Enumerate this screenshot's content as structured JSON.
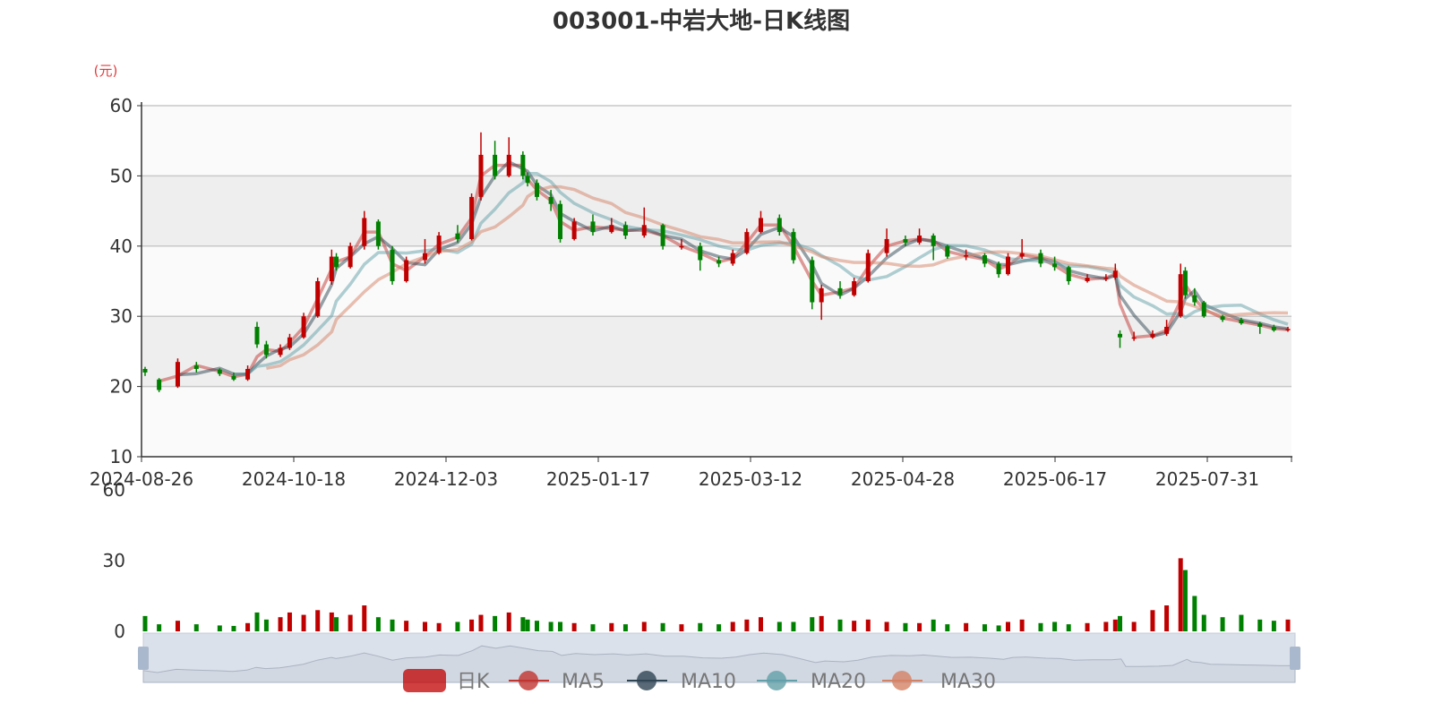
{
  "chart_data": {
    "type": "candlestick",
    "title": "003001-中岩大地-日K线图",
    "ylabel": "(元)",
    "ylim": [
      10,
      60
    ],
    "y_ticks": [
      "10",
      "20",
      "30",
      "40",
      "50",
      "60"
    ],
    "volume_ylim": [
      0,
      60
    ],
    "volume_ticks": [
      "0",
      "30",
      "60"
    ],
    "x_tick_labels": [
      "2024-08-26",
      "2024-10-18",
      "2024-12-03",
      "2025-01-17",
      "2025-03-12",
      "2025-04-28",
      "2025-06-17",
      "2025-07-31"
    ],
    "total_trading_days": 245,
    "candle_fields": [
      "day",
      "open",
      "close",
      "low",
      "high",
      "volume"
    ],
    "candles": [
      [
        0,
        22.5,
        22,
        21.5,
        22.8,
        6.5
      ],
      [
        3,
        21,
        19.5,
        19.2,
        21.2,
        3
      ],
      [
        7,
        20,
        23.5,
        19.8,
        24,
        4.5
      ],
      [
        11,
        23,
        22.5,
        22,
        23.5,
        3
      ],
      [
        16,
        22.4,
        21.8,
        21.5,
        22.6,
        2.5
      ],
      [
        19,
        21.5,
        21,
        20.8,
        22,
        2.3
      ],
      [
        22,
        21,
        22.5,
        20.8,
        23,
        3.5
      ],
      [
        24,
        28.5,
        26,
        25.5,
        29.2,
        8
      ],
      [
        26,
        26,
        24.5,
        24,
        26.5,
        5
      ],
      [
        29,
        24.5,
        25.5,
        24.2,
        26,
        6
      ],
      [
        31,
        25.5,
        27,
        25.2,
        27.5,
        8
      ],
      [
        34,
        27,
        30,
        26.8,
        30.5,
        7
      ],
      [
        37,
        30,
        35,
        29.8,
        35.5,
        9
      ],
      [
        40,
        35,
        38.5,
        34.5,
        39.5,
        8
      ],
      [
        41,
        38.5,
        37,
        36.5,
        39,
        6
      ],
      [
        44,
        37,
        40,
        36.8,
        40.5,
        7
      ],
      [
        47,
        40,
        44,
        39.5,
        45,
        11
      ],
      [
        50,
        43.5,
        40,
        39.5,
        43.8,
        6
      ],
      [
        53,
        39.5,
        35,
        34.5,
        40,
        5
      ],
      [
        56,
        35,
        38,
        34.8,
        38.5,
        4.5
      ],
      [
        60,
        38,
        39,
        37.5,
        41,
        4
      ],
      [
        63,
        39,
        41.5,
        38.8,
        42,
        3.5
      ],
      [
        67,
        41.8,
        41,
        40.5,
        43,
        4
      ],
      [
        70,
        41,
        47,
        40.8,
        47.5,
        5
      ],
      [
        72,
        47,
        53,
        46.5,
        56.2,
        7
      ],
      [
        75,
        53,
        50,
        49.5,
        55,
        6.5
      ],
      [
        78,
        50,
        53,
        49.8,
        55.5,
        8
      ],
      [
        81,
        53,
        50,
        49.5,
        53.5,
        6
      ],
      [
        82,
        50,
        49,
        48.5,
        50.5,
        5
      ],
      [
        84,
        49,
        47,
        46.5,
        49.5,
        4.5
      ],
      [
        87,
        47,
        46,
        45,
        48,
        4
      ],
      [
        89,
        46,
        41,
        40.5,
        46.5,
        4
      ],
      [
        92,
        41,
        43.5,
        40.8,
        44,
        3.5
      ],
      [
        96,
        43.5,
        42,
        41.5,
        44.5,
        3
      ],
      [
        100,
        42,
        43,
        41.8,
        44,
        3.5
      ],
      [
        103,
        43,
        41.5,
        41,
        43.5,
        3
      ],
      [
        107,
        41.5,
        43,
        41.2,
        45.5,
        4
      ],
      [
        111,
        43,
        40,
        39.5,
        43.2,
        3.5
      ],
      [
        115,
        40,
        40,
        39.5,
        41,
        3
      ],
      [
        119,
        40,
        38,
        36.5,
        40.5,
        3.5
      ],
      [
        123,
        38,
        37.5,
        37,
        38.5,
        3
      ],
      [
        126,
        37.5,
        39,
        37.2,
        39.5,
        4
      ],
      [
        129,
        39,
        42,
        38.8,
        42.5,
        5
      ],
      [
        132,
        42,
        44,
        41.8,
        45,
        6
      ],
      [
        136,
        44,
        42,
        41.5,
        44.5,
        4
      ],
      [
        139,
        42,
        38,
        37.5,
        42.5,
        4
      ],
      [
        143,
        38,
        32,
        31,
        38.5,
        6
      ],
      [
        145,
        32,
        34,
        29.5,
        34.5,
        6.5
      ],
      [
        149,
        34,
        33,
        32.5,
        35,
        5
      ],
      [
        152,
        33,
        35,
        32.8,
        35.5,
        4.5
      ],
      [
        155,
        35,
        39,
        34.8,
        39.5,
        5
      ],
      [
        159,
        39,
        41,
        38.5,
        42.5,
        4
      ],
      [
        163,
        41,
        40.5,
        40,
        41.5,
        3.5
      ],
      [
        166,
        40.5,
        41.5,
        40.2,
        42.5,
        3.5
      ],
      [
        169,
        41.5,
        40,
        38,
        41.8,
        5
      ],
      [
        172,
        40,
        38.5,
        38.2,
        40.2,
        3
      ],
      [
        176,
        38.5,
        38.7,
        38,
        39.5,
        3.5
      ],
      [
        180,
        38.7,
        37.5,
        37,
        39,
        3
      ],
      [
        183,
        37.5,
        36,
        35.5,
        37.8,
        2.5
      ],
      [
        185,
        36,
        38.5,
        35.8,
        39,
        4
      ],
      [
        188,
        38.5,
        39,
        38.2,
        41,
        5
      ],
      [
        192,
        39,
        37.5,
        37,
        39.5,
        3.5
      ],
      [
        195,
        37.5,
        37,
        36.5,
        38.5,
        4
      ],
      [
        198,
        37,
        35,
        34.5,
        37.2,
        3
      ],
      [
        202,
        35,
        35.5,
        34.8,
        36,
        3.5
      ],
      [
        206,
        35.5,
        35.5,
        35,
        36,
        4
      ],
      [
        208,
        35.5,
        36.5,
        35.2,
        37.5,
        5
      ],
      [
        209,
        27.5,
        27,
        25.5,
        28,
        6.5
      ],
      [
        212,
        27,
        27,
        26.5,
        27.8,
        4
      ],
      [
        216,
        27,
        27.5,
        26.8,
        28,
        9
      ],
      [
        219,
        27.5,
        28.5,
        27.2,
        29.5,
        11
      ],
      [
        222,
        30,
        36,
        29.8,
        37.5,
        31
      ],
      [
        223,
        36.5,
        33,
        32.5,
        37,
        26
      ],
      [
        225,
        33,
        32,
        31.5,
        34,
        15
      ],
      [
        227,
        32,
        30,
        29.8,
        32.2,
        7
      ],
      [
        231,
        30,
        29.5,
        29.2,
        30.2,
        6
      ],
      [
        235,
        29.5,
        29,
        28.8,
        29.8,
        7
      ],
      [
        239,
        29,
        28.5,
        27.5,
        29.2,
        5
      ],
      [
        242,
        28.5,
        28,
        27.8,
        28.8,
        4.5
      ],
      [
        245,
        28,
        28.2,
        27.8,
        28.5,
        5
      ]
    ],
    "legend": [
      {
        "name": "日K",
        "color": "#c23531"
      },
      {
        "name": "MA5",
        "color": "#c23531"
      },
      {
        "name": "MA10",
        "color": "#2f4554"
      },
      {
        "name": "MA20",
        "color": "#61a0a8"
      },
      {
        "name": "MA30",
        "color": "#d48265"
      }
    ],
    "up_color": "#c00000",
    "down_color": "#008000"
  }
}
